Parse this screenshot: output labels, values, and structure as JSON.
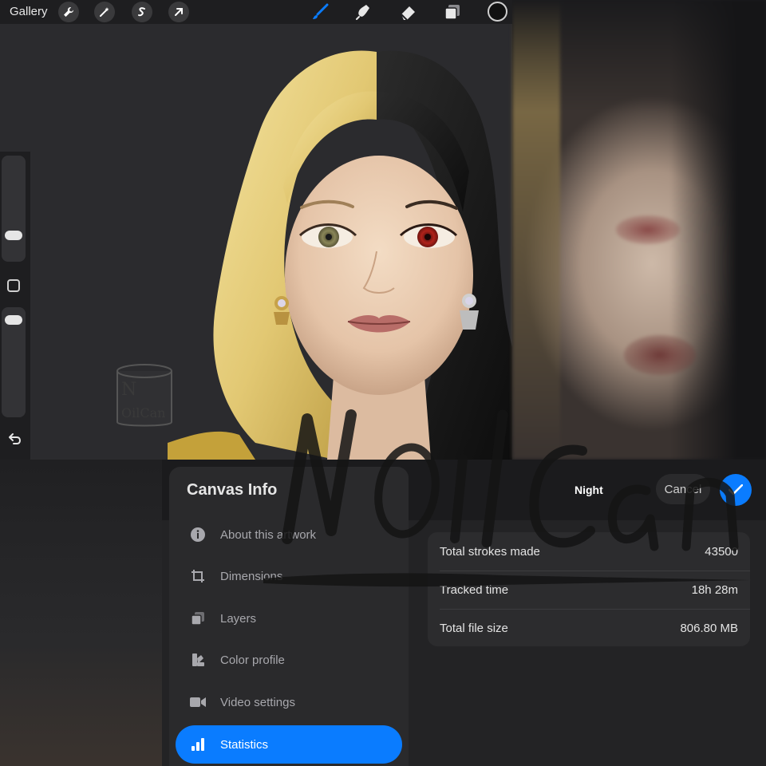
{
  "toolbar": {
    "gallery_label": "Gallery",
    "icons": [
      "wrench-icon",
      "magic-wand-icon",
      "selection-icon",
      "transform-arrow-icon",
      "brush-icon",
      "smudge-icon",
      "eraser-icon",
      "layers-icon",
      "color-swatch"
    ],
    "accent_color": "#0a7cff"
  },
  "sidebar": {
    "brush_size_level": 0.8,
    "opacity_level": 0.95
  },
  "canvas_info": {
    "title": "Canvas Info",
    "theme_label": "Night",
    "cancel_label": "Cancel",
    "menu": [
      {
        "label": "About this artwork",
        "icon": "info-icon"
      },
      {
        "label": "Dimensions",
        "icon": "crop-icon"
      },
      {
        "label": "Layers",
        "icon": "layers-icon"
      },
      {
        "label": "Color profile",
        "icon": "color-profile-icon"
      },
      {
        "label": "Video settings",
        "icon": "video-icon"
      },
      {
        "label": "Statistics",
        "icon": "bar-chart-icon",
        "active": true
      }
    ],
    "stats": [
      {
        "label": "Total strokes made",
        "value": "43500"
      },
      {
        "label": "Tracked time",
        "value": "18h 28m"
      },
      {
        "label": "Total file size",
        "value": "806.80 MB"
      }
    ]
  },
  "watermark": {
    "text": "NOilCan",
    "stamp_text": "NOilCan"
  }
}
